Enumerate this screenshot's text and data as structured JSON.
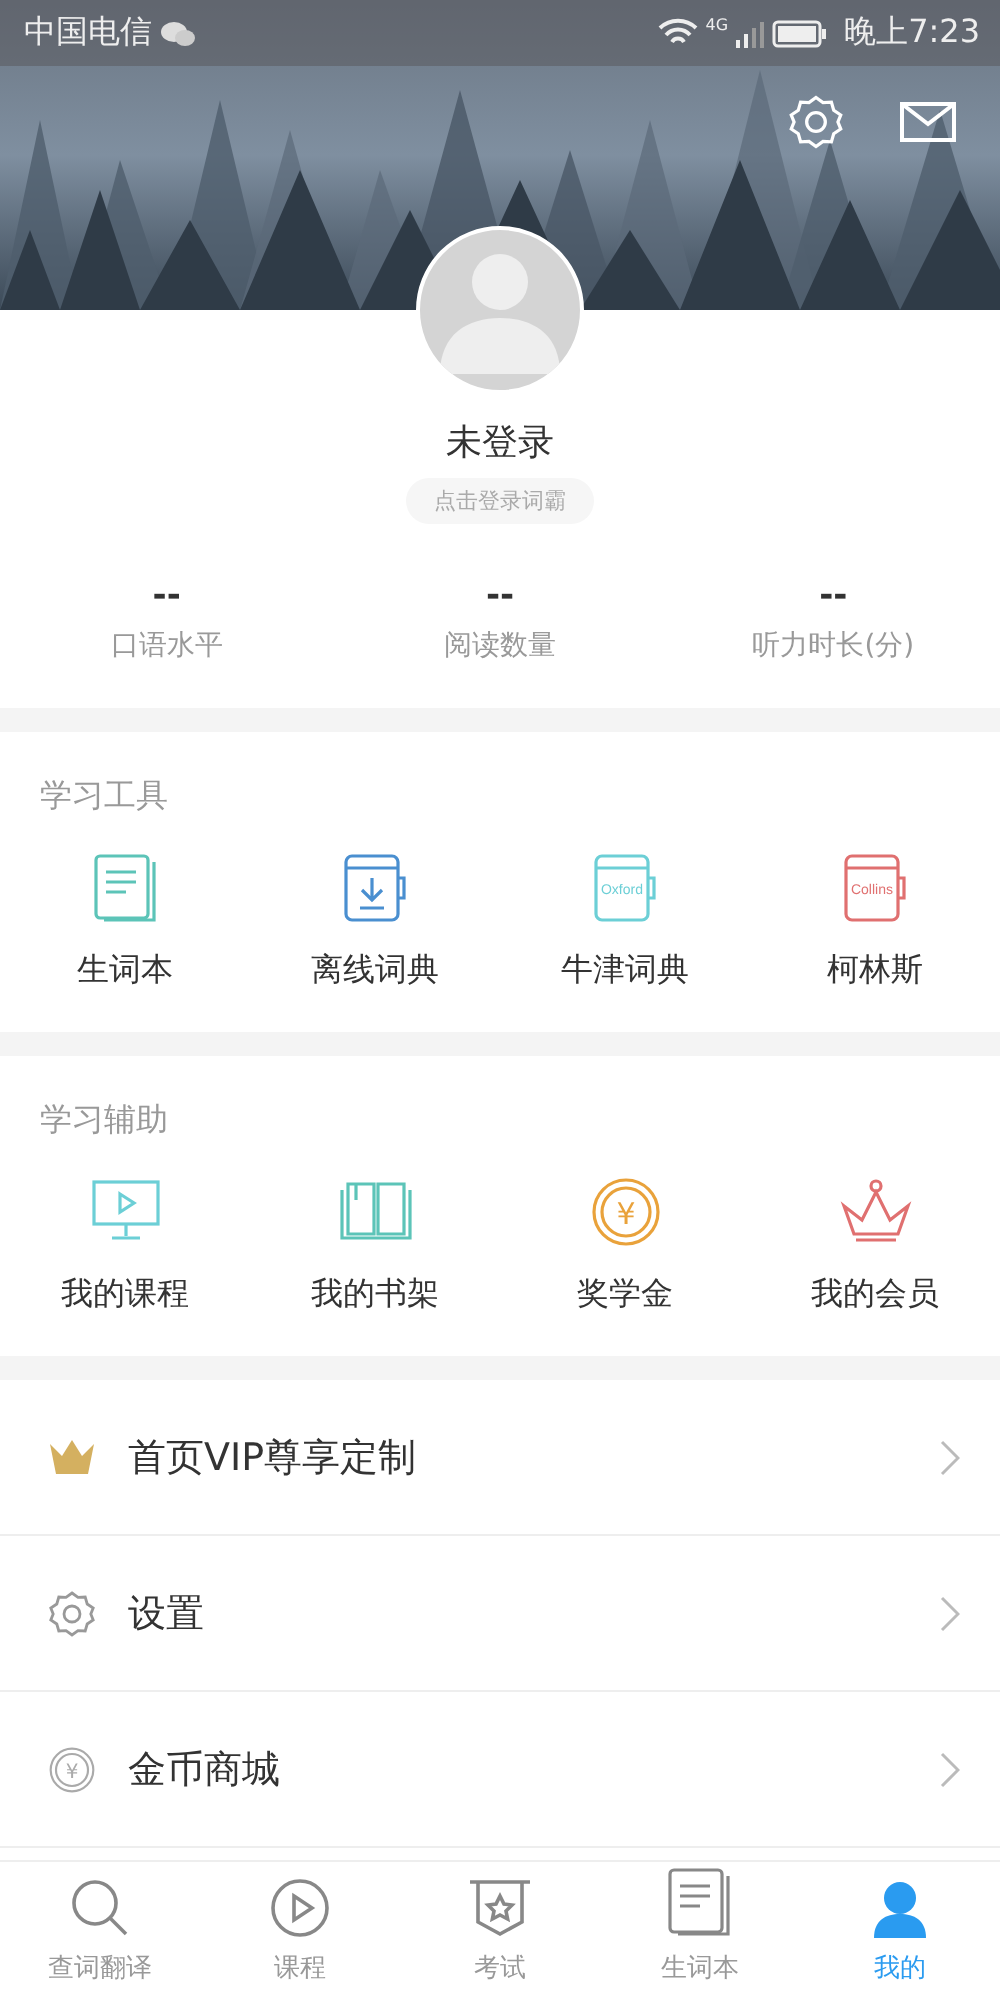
{
  "status_bar": {
    "carrier": "中国电信",
    "network": "4G",
    "time": "晚上7:23"
  },
  "profile": {
    "name": "未登录",
    "login_hint": "点击登录词霸"
  },
  "stats": [
    {
      "value": "--",
      "label": "口语水平"
    },
    {
      "value": "--",
      "label": "阅读数量"
    },
    {
      "value": "--",
      "label": "听力时长(分)"
    }
  ],
  "tools": {
    "title": "学习工具",
    "items": [
      {
        "label": "生词本",
        "kind": "notebook",
        "color": "#5cc4b8"
      },
      {
        "label": "离线词典",
        "kind": "download-book",
        "color": "#4a8fd0"
      },
      {
        "label": "牛津词典",
        "kind": "brand-book",
        "icon_text": "Oxford",
        "color": "#6ccfd6"
      },
      {
        "label": "柯林斯",
        "kind": "brand-book",
        "icon_text": "Collins",
        "color": "#e07070"
      }
    ]
  },
  "assist": {
    "title": "学习辅助",
    "items": [
      {
        "label": "我的课程",
        "kind": "monitor",
        "color": "#6ccfd6"
      },
      {
        "label": "我的书架",
        "kind": "open-book",
        "color": "#5cc4b8"
      },
      {
        "label": "奖学金",
        "kind": "coin",
        "icon_text": "¥",
        "color": "#e9a23b"
      },
      {
        "label": "我的会员",
        "kind": "crown",
        "color": "#e07070"
      }
    ]
  },
  "menu": [
    {
      "label": "首页VIP尊享定制",
      "kind": "crown"
    },
    {
      "label": "设置",
      "kind": "gear"
    },
    {
      "label": "金币商城",
      "kind": "coin",
      "icon_text": "¥"
    }
  ],
  "tabs": [
    {
      "label": "查词翻译",
      "kind": "search",
      "selected": false
    },
    {
      "label": "课程",
      "kind": "play",
      "selected": false
    },
    {
      "label": "考试",
      "kind": "badge",
      "selected": false
    },
    {
      "label": "生词本",
      "kind": "notebook",
      "selected": false
    },
    {
      "label": "我的",
      "kind": "person",
      "selected": true
    }
  ]
}
